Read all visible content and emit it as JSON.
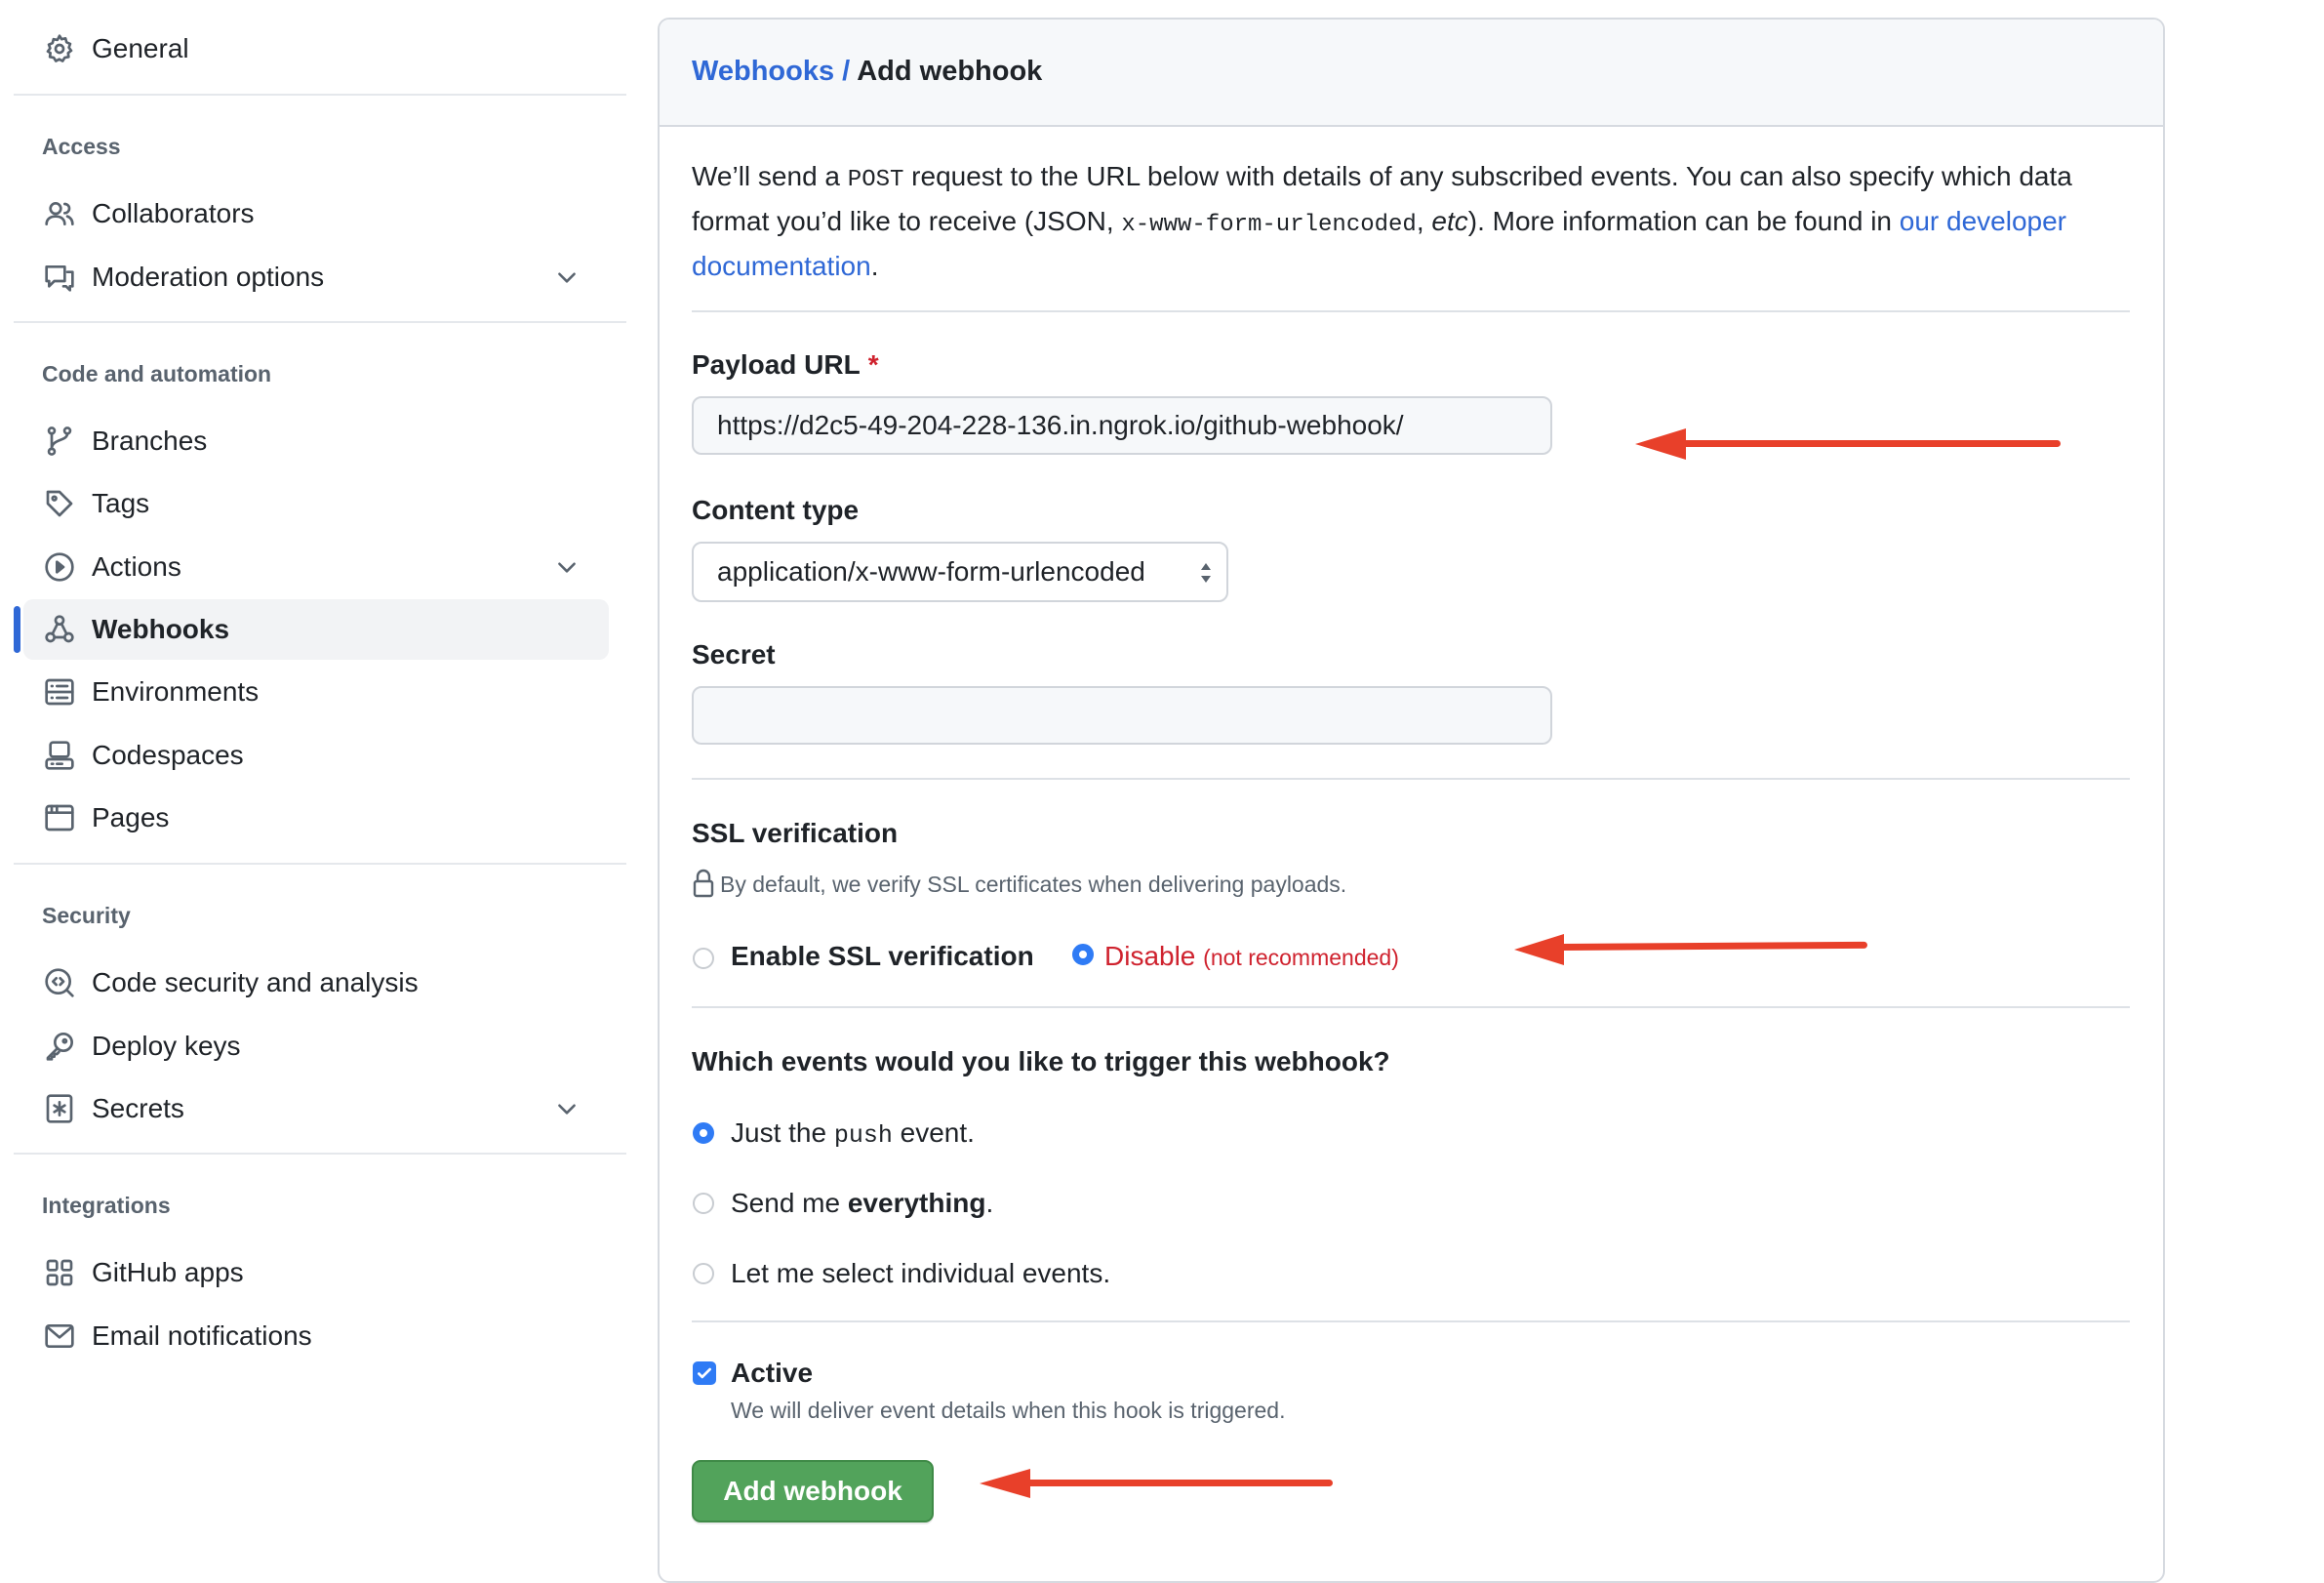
{
  "sidebar": {
    "general": {
      "label": "General",
      "icon": "gear-icon"
    },
    "sections": [
      {
        "heading": "Access",
        "items": [
          {
            "label": "Collaborators",
            "icon": "people-icon",
            "expandable": false
          },
          {
            "label": "Moderation options",
            "icon": "comment-discussion-icon",
            "expandable": true
          }
        ]
      },
      {
        "heading": "Code and automation",
        "items": [
          {
            "label": "Branches",
            "icon": "git-branch-icon",
            "expandable": false
          },
          {
            "label": "Tags",
            "icon": "tag-icon",
            "expandable": false
          },
          {
            "label": "Actions",
            "icon": "play-icon",
            "expandable": true
          },
          {
            "label": "Webhooks",
            "icon": "webhook-icon",
            "expandable": false,
            "active": true
          },
          {
            "label": "Environments",
            "icon": "server-icon",
            "expandable": false
          },
          {
            "label": "Codespaces",
            "icon": "codespaces-icon",
            "expandable": false
          },
          {
            "label": "Pages",
            "icon": "browser-icon",
            "expandable": false
          }
        ]
      },
      {
        "heading": "Security",
        "items": [
          {
            "label": "Code security and analysis",
            "icon": "codescan-icon",
            "expandable": false
          },
          {
            "label": "Deploy keys",
            "icon": "key-icon",
            "expandable": false
          },
          {
            "label": "Secrets",
            "icon": "key-asterisk-icon",
            "expandable": true
          }
        ]
      },
      {
        "heading": "Integrations",
        "items": [
          {
            "label": "GitHub apps",
            "icon": "apps-icon",
            "expandable": false
          },
          {
            "label": "Email notifications",
            "icon": "mail-icon",
            "expandable": false
          }
        ]
      }
    ]
  },
  "breadcrumb": {
    "parent": "Webhooks",
    "separator": " / ",
    "current": "Add webhook"
  },
  "intro": {
    "t1": "We’ll send a ",
    "code1": "POST",
    "t2": " request to the URL below with details of any subscribed events. You can also specify which data format you’d like to receive (JSON, ",
    "code2": "x-www-form-urlencoded",
    "t3": ", ",
    "em": "etc",
    "t4": "). More information can be found in ",
    "link": "our developer documentation",
    "t5": "."
  },
  "form": {
    "payload_url": {
      "label": "Payload URL",
      "required_mark": "*",
      "value": "https://d2c5-49-204-228-136.in.ngrok.io/github-webhook/"
    },
    "content_type": {
      "label": "Content type",
      "selected": "application/x-www-form-urlencoded"
    },
    "secret": {
      "label": "Secret",
      "value": ""
    },
    "ssl": {
      "heading": "SSL verification",
      "note": "By default, we verify SSL certificates when delivering payloads.",
      "enable_label": "Enable SSL verification",
      "disable_label": "Disable",
      "disable_note": "(not recommended)",
      "selected": "disable"
    },
    "events": {
      "question": "Which events would you like to trigger this webhook?",
      "options": [
        {
          "pre": "Just the ",
          "code": "push",
          "post": " event.",
          "selected": true
        },
        {
          "pre": "Send me ",
          "bold": "everything",
          "post": ".",
          "selected": false
        },
        {
          "pre": "Let me select individual events.",
          "selected": false
        }
      ]
    },
    "active": {
      "label": "Active",
      "checked": true,
      "note": "We will deliver event details when this hook is triggered."
    },
    "submit_label": "Add webhook"
  },
  "annotations": {
    "arrow_color": "#e8402a"
  },
  "colors": {
    "accent": "#2f68d6",
    "radio_on": "#2f7bf5",
    "primary_button": "#52a35b",
    "danger": "#cf222e"
  }
}
